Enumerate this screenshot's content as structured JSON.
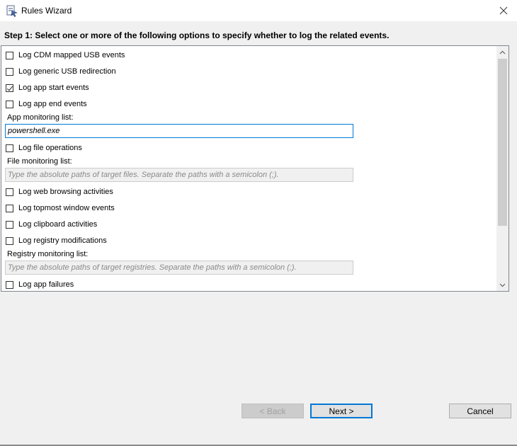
{
  "window": {
    "title": "Rules Wizard",
    "app_icon": "rules-wizard-icon",
    "close_icon": "close-icon"
  },
  "step": {
    "title": "Step 1: Select one or more of the following options to specify whether to log the related events."
  },
  "options": [
    {
      "label": "Log CDM mapped USB events",
      "checked": false
    },
    {
      "label": "Log generic USB redirection",
      "checked": false
    },
    {
      "label": "Log app start events",
      "checked": true
    },
    {
      "label": "Log app end events",
      "checked": false
    }
  ],
  "app_monitoring": {
    "label": "App monitoring list:",
    "value": "powershell.exe"
  },
  "file_ops": {
    "label": "Log file operations",
    "checked": false
  },
  "file_monitoring": {
    "label": "File monitoring list:",
    "placeholder": "Type the absolute paths of target files. Separate the paths with a semicolon (;)."
  },
  "options2": [
    {
      "label": "Log web browsing activities",
      "checked": false
    },
    {
      "label": "Log topmost window events",
      "checked": false
    },
    {
      "label": "Log clipboard activities",
      "checked": false
    },
    {
      "label": "Log registry modifications",
      "checked": false
    }
  ],
  "registry_monitoring": {
    "label": "Registry monitoring list:",
    "placeholder": "Type the absolute paths of target registries. Separate the paths with a semicolon (;)."
  },
  "app_failures": {
    "label": "Log app failures",
    "checked": false
  },
  "buttons": {
    "back": "< Back",
    "next": "Next >",
    "cancel": "Cancel"
  },
  "colors": {
    "accent": "#0078d7",
    "panel_bg": "#ffffff",
    "window_bg": "#f0f0f0"
  }
}
